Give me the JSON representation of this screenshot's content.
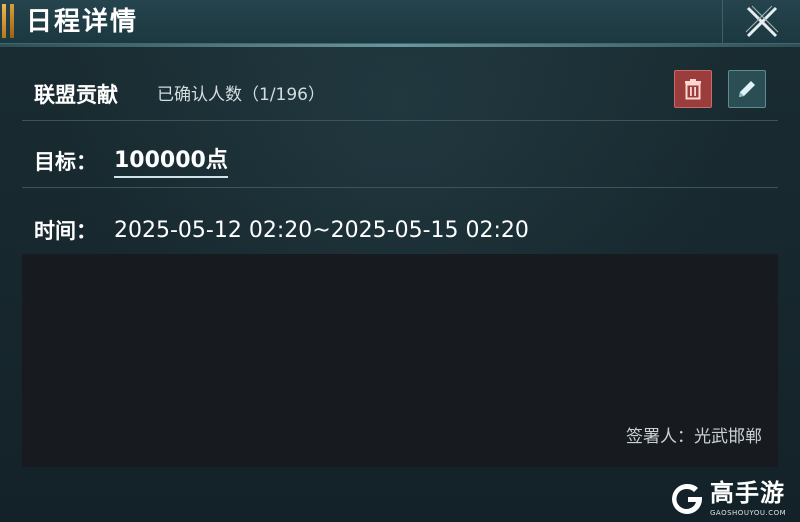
{
  "header": {
    "title": "日程详情",
    "close_icon": "close-x-icon"
  },
  "event": {
    "name": "联盟贡献",
    "confirmed_text": "已确认人数（1/196）",
    "delete_icon": "trash-icon",
    "edit_icon": "pencil-icon"
  },
  "goal": {
    "label": "目标：",
    "value": "100000点"
  },
  "time": {
    "label": "时间：",
    "value": "2025-05-12 02:20~2025-05-15 02:20"
  },
  "content": {
    "signer": "签署人：光武邯郸"
  },
  "watermark": {
    "brand": "高手游",
    "domain": "GAOSHOUYOU.COM"
  },
  "colors": {
    "background": "#16262c",
    "header": "#25444d",
    "delete": "#9a3d3c",
    "edit": "#2b4e55",
    "content_box": "#171b1f",
    "accent_gold": "#f0b64e"
  }
}
